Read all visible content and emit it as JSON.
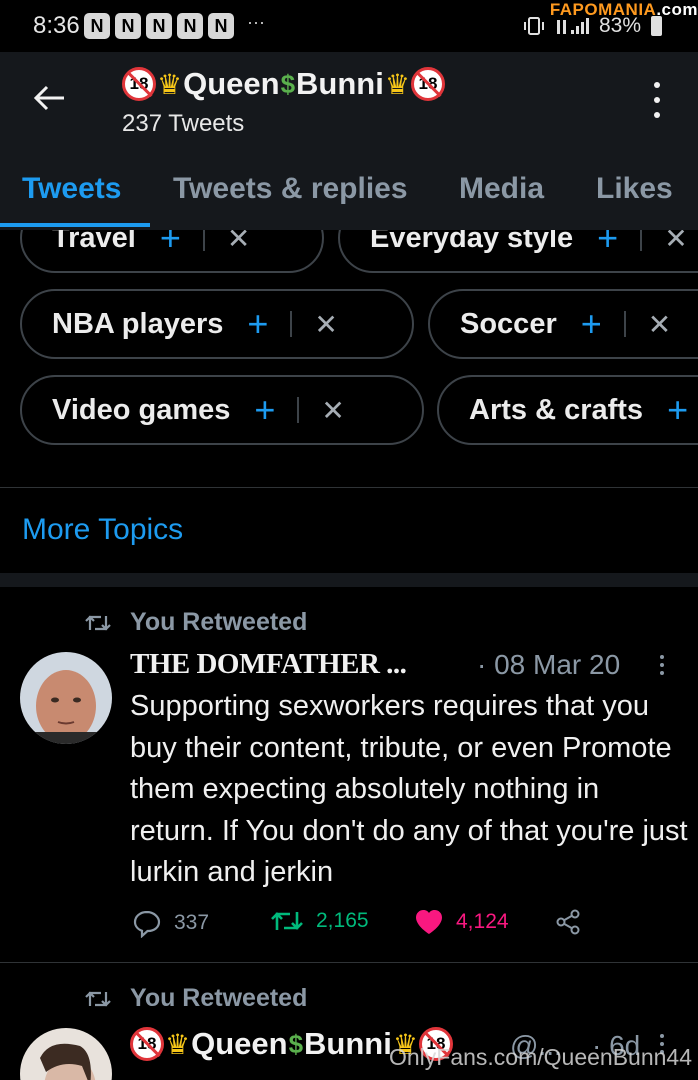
{
  "status_bar": {
    "time": "8:36",
    "notification_icons": [
      "N",
      "N",
      "N",
      "N",
      "N"
    ],
    "more": "···",
    "battery": "83%"
  },
  "watermark": {
    "part1": "FAPOMANIA",
    "part2": ".com"
  },
  "header": {
    "name_part1": "Queen",
    "name_part2": "Bunni",
    "badge_text": "18",
    "tweet_count": "237 Tweets"
  },
  "tabs": [
    {
      "label": "Tweets",
      "active": true
    },
    {
      "label": "Tweets & replies",
      "active": false
    },
    {
      "label": "Media",
      "active": false
    },
    {
      "label": "Likes",
      "active": false
    }
  ],
  "topics": [
    {
      "label": "Travel"
    },
    {
      "label": "Everyday style"
    },
    {
      "label": "NBA players"
    },
    {
      "label": "Soccer"
    },
    {
      "label": "Video games"
    },
    {
      "label": "Arts & crafts"
    }
  ],
  "more_topics": "More Topics",
  "tweets": [
    {
      "retweet_label": "You Retweeted",
      "author": "THE DOMFATHER ...",
      "date": "· 08 Mar 20",
      "text": "Supporting sexworkers requires that you buy their content, tribute, or even Promote them expecting absolutely nothing in return. If You don't do any of that you're just lurkin and jerkin",
      "replies": "337",
      "retweets": "2,165",
      "likes": "4,124"
    },
    {
      "retweet_label": "You Retweeted",
      "handle": "@...",
      "date": "· 6d"
    }
  ],
  "footer_watermark": "OnlyFans.com/QueenBunn44",
  "colors": {
    "accent": "#1d9bf0",
    "retweet_green": "#00ba7c",
    "like_pink": "#f91880",
    "secondary": "#8b98a5"
  }
}
